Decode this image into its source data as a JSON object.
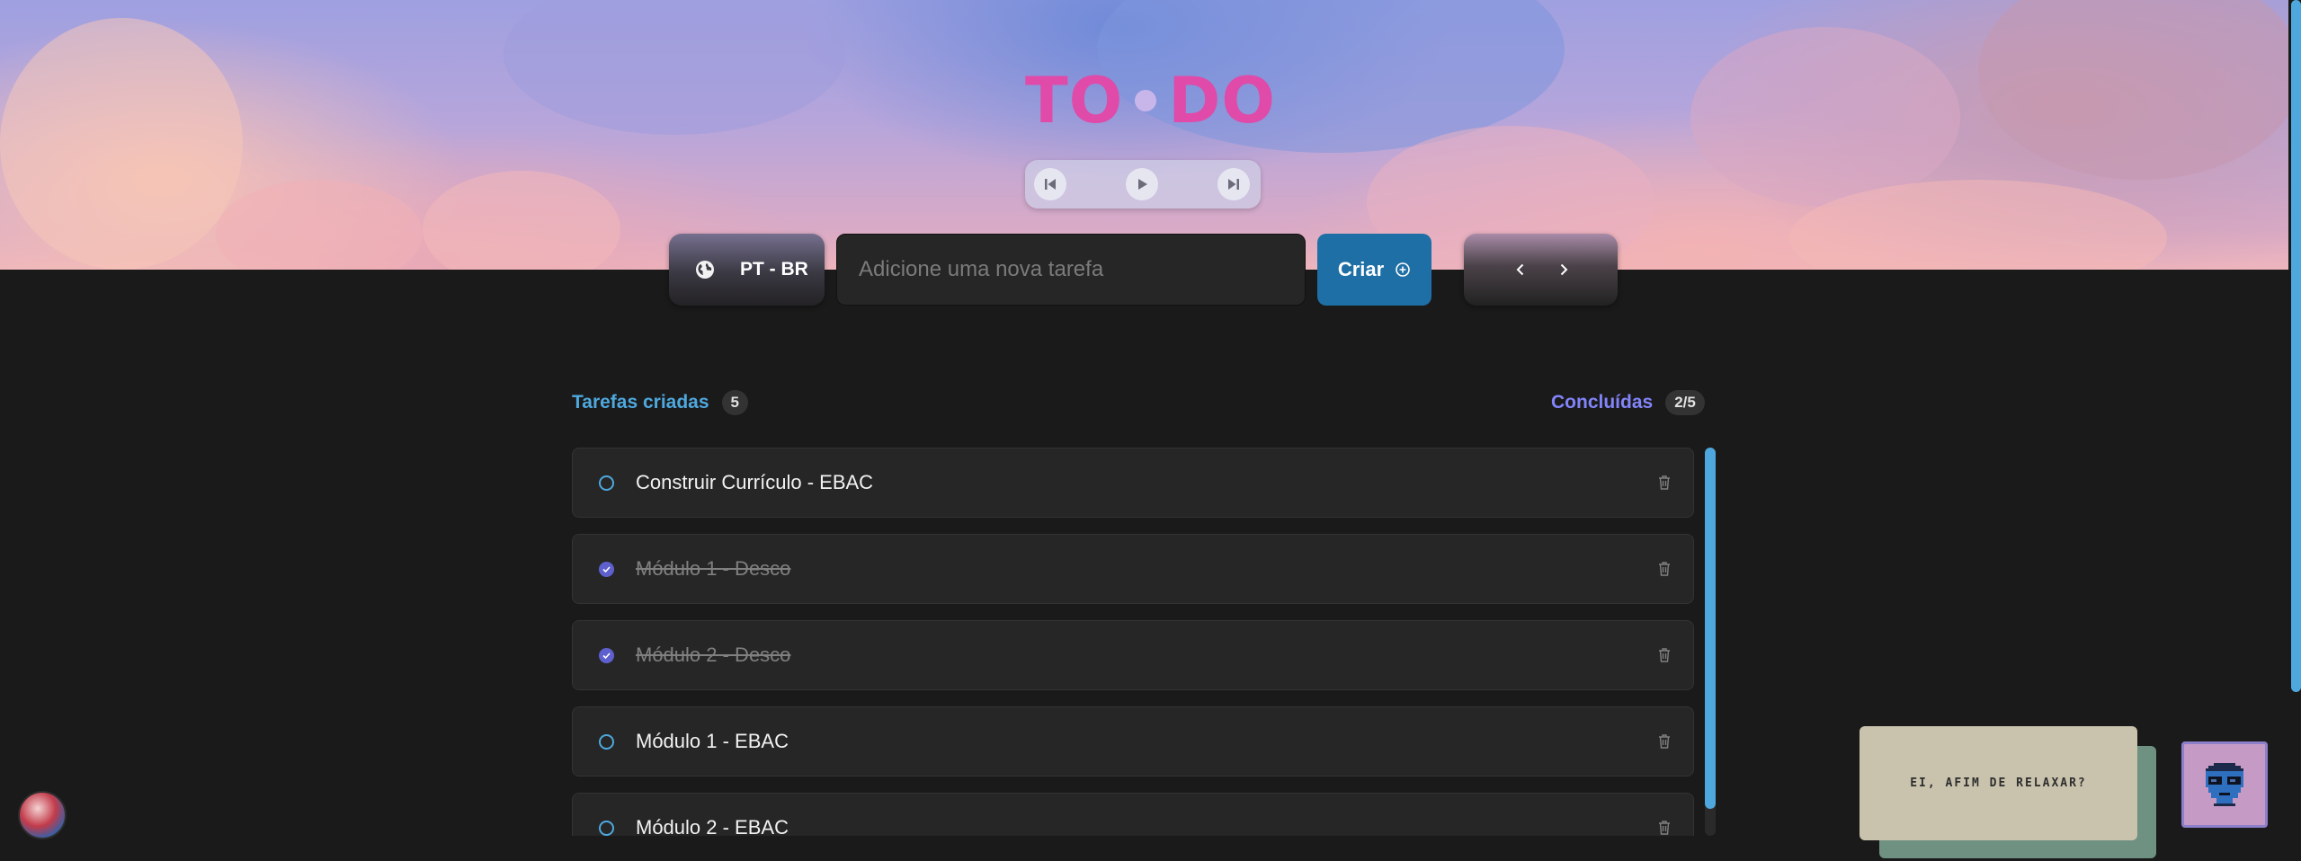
{
  "header": {
    "title_left": "TO",
    "title_right": "DO"
  },
  "player": {
    "prev_icon": "skip-back-icon",
    "play_icon": "play-icon",
    "next_icon": "skip-forward-icon"
  },
  "language": {
    "icon": "globe-icon",
    "label": "PT - BR"
  },
  "new_task": {
    "placeholder": "Adicione uma nova tarefa",
    "value": ""
  },
  "create_button": {
    "label": "Criar",
    "icon": "plus-circle-icon"
  },
  "pager": {
    "prev_icon": "chevron-left-icon",
    "next_icon": "chevron-right-icon"
  },
  "summary": {
    "created_label": "Tarefas criadas",
    "created_count": "5",
    "done_label": "Concluídas",
    "done_count": "2/5"
  },
  "tasks": [
    {
      "text": "Construir Currículo - EBAC",
      "done": false
    },
    {
      "text": "Módulo 1 - Desco",
      "done": true
    },
    {
      "text": "Módulo 2 - Desco",
      "done": true
    },
    {
      "text": "Módulo 1 - EBAC",
      "done": false
    },
    {
      "text": "Módulo 2 - EBAC",
      "done": false
    }
  ],
  "relax_card": {
    "text": "EI, AFIM DE RELAXAR?"
  },
  "colors": {
    "accent_blue": "#4ea8de",
    "accent_purple": "#8284fa",
    "title_pink": "#e04aa8",
    "create_button": "#1e6fa5",
    "background": "#1a1a1a"
  }
}
